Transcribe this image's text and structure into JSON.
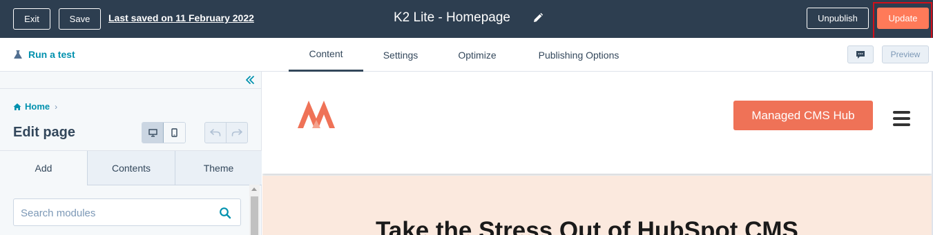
{
  "topbar": {
    "exit_label": "Exit",
    "save_label": "Save",
    "last_saved": "Last saved on 11 February 2022",
    "page_title": "K2 Lite - Homepage",
    "unpublish_label": "Unpublish",
    "update_label": "Update"
  },
  "navbar": {
    "run_test_label": "Run a test",
    "tabs": [
      {
        "label": "Content",
        "active": true
      },
      {
        "label": "Settings"
      },
      {
        "label": "Optimize"
      },
      {
        "label": "Publishing Options"
      }
    ],
    "preview_label": "Preview"
  },
  "sidebar": {
    "breadcrumb": "Home",
    "title": "Edit page",
    "tabs": [
      {
        "label": "Add",
        "active": true
      },
      {
        "label": "Contents"
      },
      {
        "label": "Theme"
      }
    ],
    "search_placeholder": "Search modules"
  },
  "preview": {
    "cta_label": "Managed CMS Hub",
    "hero_title": "Take the Stress Out of HubSpot CMS"
  },
  "colors": {
    "topbar_bg": "#2d3e50",
    "accent": "#ff7a59",
    "link": "#0091ae",
    "cta": "#ef7257",
    "hero_bg": "#fbe9de",
    "highlight_outline": "#d1101a"
  },
  "icons": [
    "pencil-icon",
    "flask-icon",
    "comment-icon",
    "collapse-icon",
    "home-icon",
    "chevron-right-icon",
    "desktop-icon",
    "mobile-icon",
    "undo-icon",
    "redo-icon",
    "search-icon",
    "logo-icon",
    "menu-icon"
  ]
}
